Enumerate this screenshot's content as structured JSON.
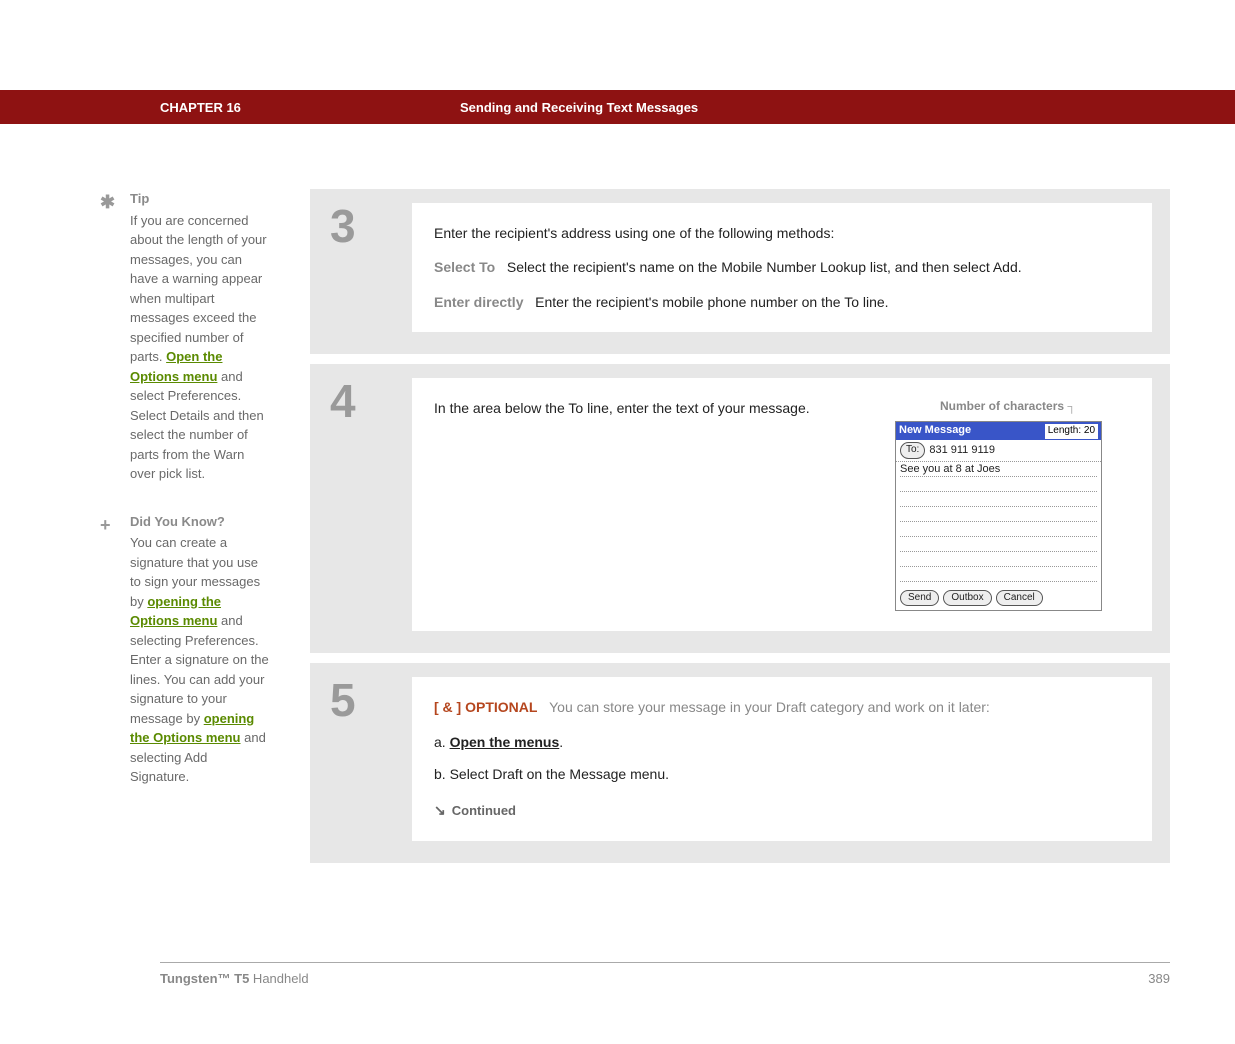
{
  "header": {
    "chapter": "CHAPTER 16",
    "title": "Sending and Receiving Text Messages"
  },
  "sidebar": {
    "tip": {
      "heading": "Tip",
      "text1": "If you are concerned about the length of your messages, you can have a warning appear when multipart messages exceed the specified number of parts. ",
      "link1": "Open the Options menu",
      "text2": " and select Preferences. Select Details and then select the number of parts from the Warn over pick list."
    },
    "dyk": {
      "heading": "Did You Know?",
      "text1": "You can create a signature that you use to sign your messages by ",
      "link1": "opening the Options menu",
      "text2": " and selecting Preferences. Enter a signature on the lines. You can add your signature to your message by ",
      "link2": "opening the Options menu",
      "text3": " and selecting Add Signature."
    }
  },
  "steps": {
    "s3": {
      "num": "3",
      "intro": "Enter the recipient's address using one of the following methods:",
      "m1_label": "Select To",
      "m1_text": "Select the recipient's name on the Mobile Number Lookup list, and then select Add.",
      "m2_label": "Enter directly",
      "m2_text": "Enter the recipient's mobile phone number on the To line."
    },
    "s4": {
      "num": "4",
      "text": "In the area below the To line, enter the text of your message.",
      "caption": "Number of characters",
      "ss": {
        "title": "New Message",
        "length": "Length: 20",
        "to": "To:",
        "phone": "831 911 9119",
        "msgline": "See you at 8 at Joes",
        "send": "Send",
        "outbox": "Outbox",
        "cancel": "Cancel"
      }
    },
    "s5": {
      "num": "5",
      "tag": "[ & ]  OPTIONAL",
      "intro": "You can store your message in your Draft category and work on it later:",
      "a_prefix": "a.  ",
      "a_link": "Open the menus",
      "a_suffix": ".",
      "b": "b.  Select Draft on the Message menu.",
      "continued": "Continued"
    }
  },
  "footer": {
    "product": "Tungsten™ T5",
    "suffix": " Handheld",
    "page": "389"
  }
}
